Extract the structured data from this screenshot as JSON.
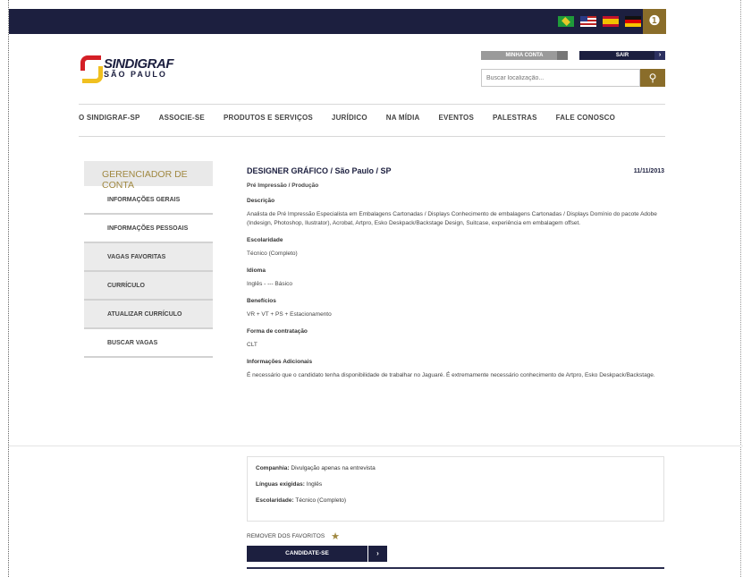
{
  "header": {
    "flags": [
      "flag-brazil",
      "flag-usa",
      "flag-spain",
      "flag-germany"
    ],
    "globe_icon": "globe-icon",
    "account_label": "MINHA CONTA",
    "exit_label": "SAIR",
    "search_placeholder": "Buscar localização...",
    "search_icon": "search-icon"
  },
  "logo": {
    "title": "SINDIGRAF",
    "subtitle": "SÃO PAULO"
  },
  "nav": [
    "O SINDIGRAF-SP",
    "ASSOCIE-SE",
    "PRODUTOS E SERVIÇOS",
    "JURÍDICO",
    "NA MÍDIA",
    "EVENTOS",
    "PALESTRAS",
    "FALE CONOSCO"
  ],
  "sidebar": {
    "title": "GERENCIADOR DE CONTA",
    "items": [
      "INFORMAÇÕES GERAIS",
      "INFORMAÇÕES PESSOAIS",
      "VAGAS FAVORITAS",
      "CURRÍCULO",
      "ATUALIZAR CURRÍCULO",
      "BUSCAR VAGAS"
    ]
  },
  "job": {
    "title": "DESIGNER GRÁFICO / São Paulo / SP",
    "date": "11/11/2013",
    "category": "Pré Impressão / Produção",
    "description_label": "Descrição",
    "description": "Analista de Pré Impressão Especialista em Embalagens Cartonadas / Displays Conhecimento de embalagens Cartonadas / Displays Domínio do pacote Adobe (Indesign, Photoshop, Ilustrator), Acrobat, Artpro, Esko Deskpack/Backstage Design, Suitcase, experiência em embalagem offset.",
    "education_label": "Escolaridade",
    "education": "Técnico (Completo)",
    "language_label": "Idioma",
    "language": "Inglês - --- Básico",
    "benefits_label": "Benefícios",
    "benefits": "VR + VT + PS + Estacionamento",
    "hiring_label": "Forma de contratação",
    "hiring": "CLT",
    "extra_label": "Informações Adicionais",
    "extra": "É necessário que o candidato tenha disponibilidade de trabalhar no Jaguaré. É extremamente necessário conhecimento de Artpro, Esko Deskpack/Backstage."
  },
  "summary": {
    "company_label": "Companhia:",
    "company": "Divulgação apenas na entrevista",
    "languages_label": "Línguas exigidas:",
    "languages": "Inglês",
    "education_label": "Escolaridade:",
    "education": "Técnico (Completo)"
  },
  "actions": {
    "remove_favorite": "REMOVER DOS FAVORITOS",
    "apply": "CANDIDATE-SE",
    "apply_arrow": "›",
    "star_icon": "star-icon"
  },
  "colors": {
    "navy": "#1c1f3f",
    "gold": "#8a6d2a",
    "accent": "#a08840"
  }
}
